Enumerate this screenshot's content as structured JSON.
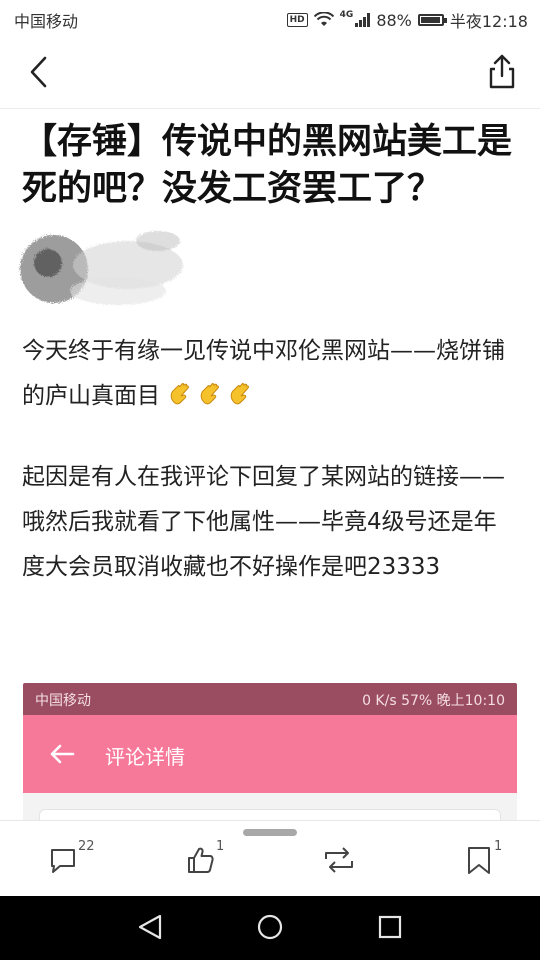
{
  "status_bar": {
    "carrier": "中国移动",
    "hd": "HD",
    "network": "4G",
    "battery": "88%",
    "battery_level": 0.88,
    "time": "半夜12:18"
  },
  "article": {
    "title": "【存锤】传说中的黑网站美工是死的吧？没发工资罢工了？",
    "paragraph1": "今天终于有缘一见传说中邓伦黑网站——烧饼铺的庐山真面目",
    "paragraph2": "起因是有人在我评论下回复了某网站的链接——哦然后我就看了下他属性——毕竟4级号还是年度大会员取消收藏也不好操作是吧23333"
  },
  "embedded_screenshot": {
    "carrier": "中国移动",
    "status_right": "0 K/s  57%  晚上10:10",
    "battery": "57%",
    "title": "评论详情",
    "bar_color": "#f7799a"
  },
  "bottom_bar": {
    "comment_count": "22",
    "like_count": "1",
    "favorite_count": "1"
  },
  "colors": {
    "accent": "#f7799a",
    "text": "#1a1a1a"
  }
}
